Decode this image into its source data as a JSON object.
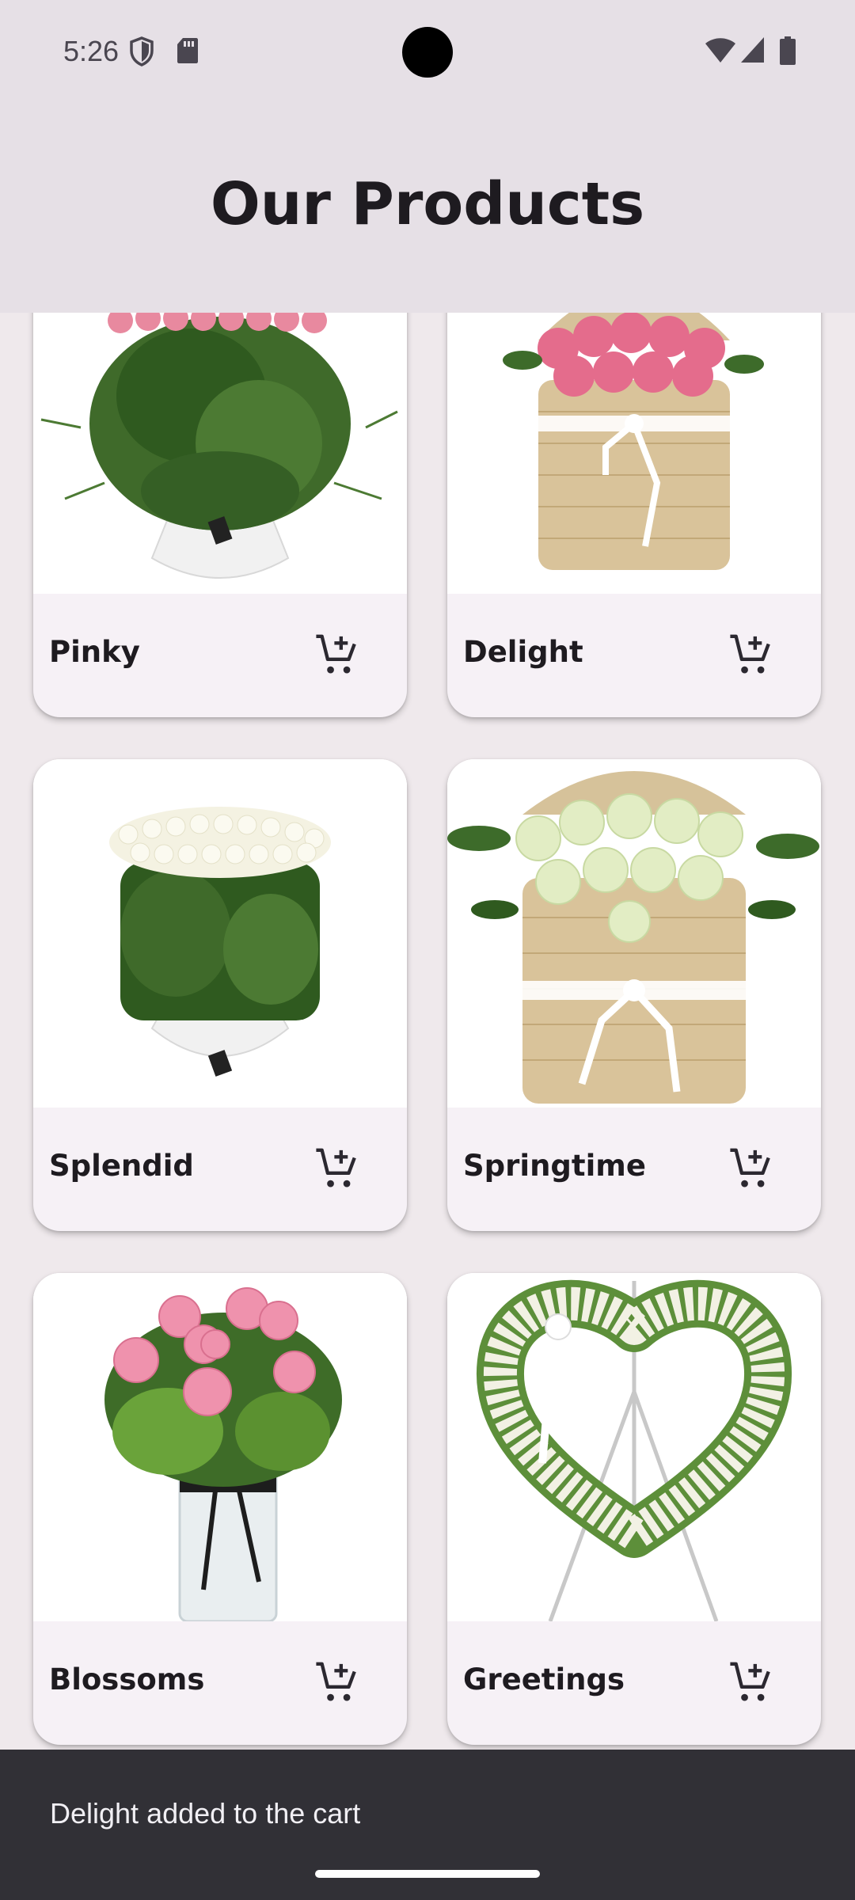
{
  "status_bar": {
    "time": "5:26",
    "left_icons": [
      "shield-icon",
      "sd-card-icon"
    ],
    "right_icons": [
      "wifi-icon",
      "cellular-signal-icon",
      "battery-icon"
    ]
  },
  "app_bar": {
    "title": "Our Products"
  },
  "products": [
    {
      "name": "Pinky",
      "image": "pink-roses-tall-arrangement",
      "cart_icon": "add-to-cart-icon"
    },
    {
      "name": "Delight",
      "image": "pink-roses-straw-basket",
      "cart_icon": "add-to-cart-icon"
    },
    {
      "name": "Splendid",
      "image": "white-roses-tall-arrangement",
      "cart_icon": "add-to-cart-icon"
    },
    {
      "name": "Springtime",
      "image": "white-roses-straw-basket",
      "cart_icon": "add-to-cart-icon"
    },
    {
      "name": "Blossoms",
      "image": "pink-roses-glass-vase",
      "cart_icon": "add-to-cart-icon"
    },
    {
      "name": "Greetings",
      "image": "white-heart-wreath-stand",
      "cart_icon": "add-to-cart-icon"
    }
  ],
  "snackbar": {
    "message": "Delight added to the cart"
  },
  "colors": {
    "background": "#efe9ec",
    "app_bar": "#e6e0e6",
    "card": "#f6f1f6",
    "snackbar": "#313036",
    "text_primary": "#1e1b20"
  }
}
